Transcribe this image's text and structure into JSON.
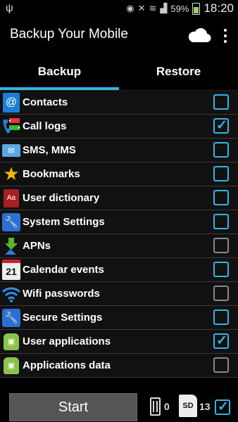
{
  "statusbar": {
    "battery_percent": "59%",
    "time": "18:20"
  },
  "app": {
    "title": "Backup Your Mobile"
  },
  "tabs": [
    {
      "label": "Backup",
      "active": true
    },
    {
      "label": "Restore",
      "active": false
    }
  ],
  "items": [
    {
      "label": "Contacts",
      "icon": "contacts-icon",
      "checked": false,
      "enabled": true
    },
    {
      "label": "Call logs",
      "icon": "call-logs-icon",
      "checked": true,
      "enabled": true
    },
    {
      "label": "SMS, MMS",
      "icon": "sms-icon",
      "checked": false,
      "enabled": true
    },
    {
      "label": "Bookmarks",
      "icon": "star-icon",
      "checked": false,
      "enabled": true
    },
    {
      "label": "User dictionary",
      "icon": "dictionary-icon",
      "checked": false,
      "enabled": true
    },
    {
      "label": "System Settings",
      "icon": "wrench-icon",
      "checked": false,
      "enabled": true
    },
    {
      "label": "APNs",
      "icon": "apn-icon",
      "checked": false,
      "enabled": false
    },
    {
      "label": "Calendar events",
      "icon": "calendar-icon",
      "checked": false,
      "enabled": true
    },
    {
      "label": "Wifi passwords",
      "icon": "wifi-icon",
      "checked": false,
      "enabled": false
    },
    {
      "label": "Secure Settings",
      "icon": "wrench-icon",
      "checked": false,
      "enabled": true
    },
    {
      "label": "User applications",
      "icon": "android-icon",
      "checked": true,
      "enabled": true
    },
    {
      "label": "Applications data",
      "icon": "android-icon",
      "checked": false,
      "enabled": false
    }
  ],
  "bottom": {
    "start_label": "Start",
    "internal_count": "0",
    "sd_count": "13",
    "sd_checked": true
  },
  "colors": {
    "accent": "#33b5e5",
    "disabled_checkbox": "#8a8a8a"
  }
}
